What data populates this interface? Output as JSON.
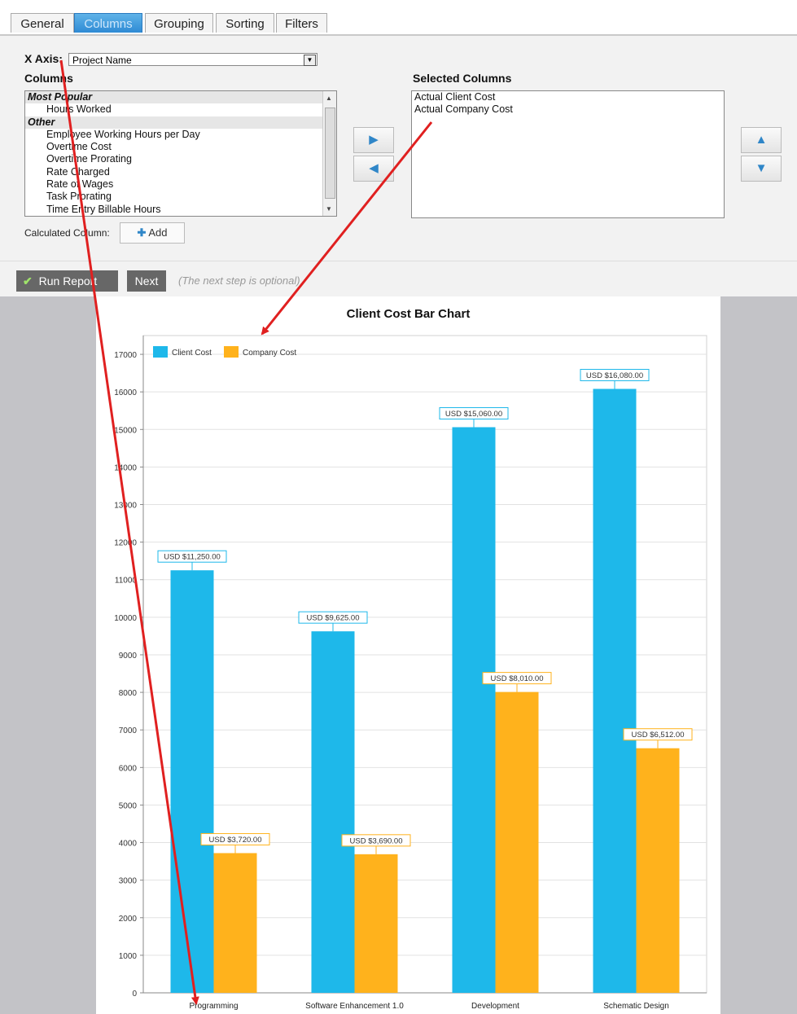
{
  "tabs": [
    {
      "label": "General"
    },
    {
      "label": "Columns",
      "active": true
    },
    {
      "label": "Grouping"
    },
    {
      "label": "Sorting"
    },
    {
      "label": "Filters"
    }
  ],
  "xaxis": {
    "label": "X Axis:",
    "selected": "Project Name"
  },
  "columns": {
    "heading": "Columns",
    "groups": [
      {
        "name": "Most Popular",
        "items": [
          "Hours Worked"
        ]
      },
      {
        "name": "Other",
        "items": [
          "Employee Working Hours per Day",
          "Overtime Cost",
          "Overtime Prorating",
          "Rate Charged",
          "Rate of Wages",
          "Task Prorating",
          "Time Entry Billable Hours"
        ]
      }
    ]
  },
  "selected_columns": {
    "heading": "Selected Columns",
    "items": [
      "Actual Client Cost",
      "Actual Company Cost"
    ]
  },
  "calculated": {
    "label": "Calculated Column:",
    "add_label": "Add"
  },
  "actions": {
    "run_label": "Run Report",
    "next_label": "Next",
    "hint": "(The next step is optional)"
  },
  "colors": {
    "client": "#1eb8ea",
    "company": "#ffb21c",
    "arrow": "#e02020",
    "accent": "#2f86c8"
  },
  "chart_data": {
    "type": "bar",
    "title": "Client Cost Bar Chart",
    "categories": [
      "Programming",
      "Software Enhancement 1.0",
      "Development",
      "Schematic Design"
    ],
    "series": [
      {
        "name": "Client Cost",
        "values": [
          11250,
          9625,
          15060,
          16080
        ],
        "labels": [
          "USD $11,250.00",
          "USD $9,625.00",
          "USD $15,060.00",
          "USD $16,080.00"
        ]
      },
      {
        "name": "Company Cost",
        "values": [
          3720,
          3690,
          8010,
          6512
        ],
        "labels": [
          "USD $3,720.00",
          "USD $3,690.00",
          "USD $8,010.00",
          "USD $6,512.00"
        ]
      }
    ],
    "yticks": [
      0,
      1000,
      2000,
      3000,
      4000,
      5000,
      6000,
      7000,
      8000,
      9000,
      10000,
      11000,
      12000,
      13000,
      14000,
      15000,
      16000,
      17000
    ],
    "ylim": [
      0,
      17500
    ],
    "legend": "top-left",
    "grid": true
  }
}
